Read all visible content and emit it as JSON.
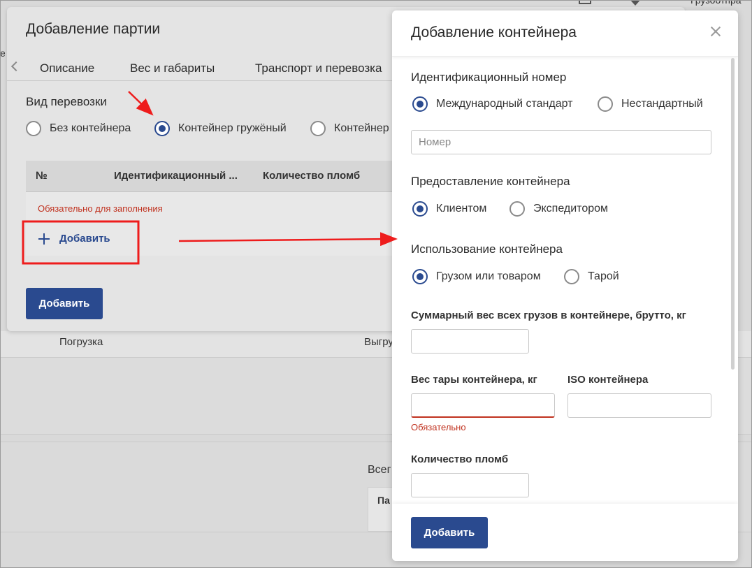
{
  "background": {
    "loading_label": "Погрузка",
    "unloading_label": "Выгру",
    "total_label": "Всег",
    "party_label": "Па",
    "top_right_text": "Грузоотпра",
    "left_edge_text": "е"
  },
  "party_modal": {
    "title": "Добавление партии",
    "tabs": [
      {
        "label": "Описание"
      },
      {
        "label": "Вес и габариты"
      },
      {
        "label": "Транспорт и перевозка"
      }
    ],
    "transport_type": {
      "label": "Вид перевозки",
      "options": [
        {
          "label": "Без контейнера",
          "selected": false
        },
        {
          "label": "Контейнер гружёный",
          "selected": true
        },
        {
          "label": "Контейнер",
          "selected": false
        }
      ]
    },
    "containers_table": {
      "columns": [
        "№",
        "Идентификационный ...",
        "Количество пломб"
      ],
      "required_note": "Обязательно для заполнения",
      "add_label": "Добавить"
    },
    "submit_label": "Добавить"
  },
  "container_drawer": {
    "title": "Добавление контейнера",
    "id_number": {
      "label": "Идентификационный номер",
      "options": [
        {
          "label": "Международный стандарт",
          "selected": true
        },
        {
          "label": "Нестандартный",
          "selected": false
        }
      ],
      "placeholder": "Номер",
      "value": ""
    },
    "provision": {
      "label": "Предоставление контейнера",
      "options": [
        {
          "label": "Клиентом",
          "selected": true
        },
        {
          "label": "Экспедитором",
          "selected": false
        }
      ]
    },
    "usage": {
      "label": "Использование контейнера",
      "options": [
        {
          "label": "Грузом или товаром",
          "selected": true
        },
        {
          "label": "Тарой",
          "selected": false
        }
      ]
    },
    "gross_weight": {
      "label": "Суммарный вес всех грузов в контейнере, брутто, кг",
      "value": ""
    },
    "tare_weight": {
      "label": "Вес тары контейнера, кг",
      "value": "",
      "error": "Обязательно"
    },
    "iso": {
      "label": "ISO контейнера",
      "value": ""
    },
    "seals_count": {
      "label": "Количество пломб",
      "value": ""
    },
    "submit_label": "Добавить"
  },
  "colors": {
    "primary": "#2a4a8f",
    "error": "#c0311e",
    "annotation": "#ee1c1c"
  }
}
